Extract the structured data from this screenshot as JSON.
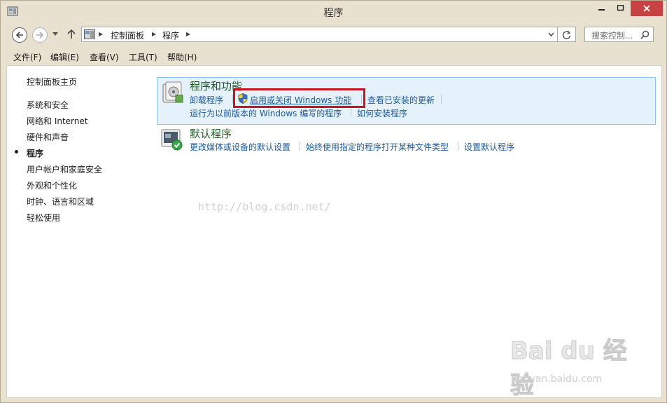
{
  "window": {
    "title": "程序"
  },
  "address": {
    "crumbs": [
      "控制面板",
      "程序"
    ],
    "search_placeholder": "搜索控制..."
  },
  "menu": [
    "文件(F)",
    "编辑(E)",
    "查看(V)",
    "工具(T)",
    "帮助(H)"
  ],
  "sidebar": {
    "home": "控制面板主页",
    "items": [
      "系统和安全",
      "网络和 Internet",
      "硬件和声音",
      "程序",
      "用户帐户和家庭安全",
      "外观和个性化",
      "时钟、语言和区域",
      "轻松使用"
    ],
    "active": "程序"
  },
  "categories": [
    {
      "title": "程序和功能",
      "icon": "programs-features-icon",
      "links_row1": [
        "卸载程序",
        "启用或关闭 Windows 功能",
        "查看已安装的更新"
      ],
      "links_row2": [
        "运行为以前版本的 Windows 编写的程序",
        "如何安装程序"
      ]
    },
    {
      "title": "默认程序",
      "icon": "default-programs-icon",
      "links_row1": [
        "更改媒体或设备的默认设置",
        "始终使用指定的程序打开某种文件类型",
        "设置默认程序"
      ]
    }
  ],
  "watermark": "http://blog.csdn.net/",
  "baidu": {
    "word": "Bai du 经验",
    "url": "jingyan.baidu.com"
  },
  "colors": {
    "accent_highlight": "#c8141e",
    "link": "#1e5a9e",
    "category_title": "#1e5a1e",
    "close_button": "#c74343"
  }
}
